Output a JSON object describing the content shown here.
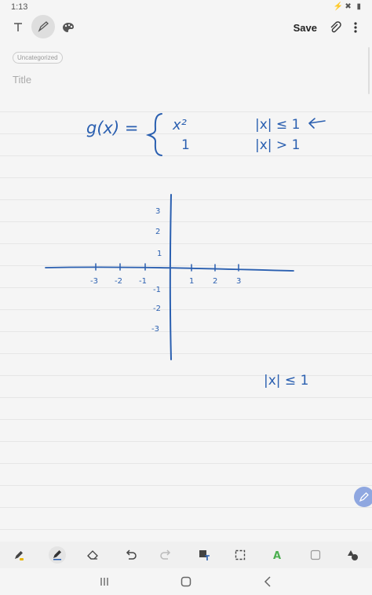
{
  "status": {
    "time": "1:13",
    "extra": "⸬"
  },
  "toolbar": {
    "save_label": "Save"
  },
  "tag": "Uncategorized",
  "title_placeholder": "Title",
  "handwriting": {
    "func_name": "g(x) =",
    "case1_expr": "x²",
    "case2_expr": "1",
    "cond1": "|x| ≤ 1",
    "cond2": "|x| > 1",
    "note": "|x| ≤ 1"
  },
  "axis_ticks": {
    "x_neg": [
      "-3",
      "-2",
      "-1"
    ],
    "x_pos": [
      "1",
      "2",
      "3"
    ],
    "y_pos": [
      "3",
      "2",
      "1"
    ],
    "y_neg": [
      "-1",
      "-2",
      "-3"
    ]
  },
  "colors": {
    "ink": "#2a5fb0",
    "fab": "#8fa7e0"
  }
}
